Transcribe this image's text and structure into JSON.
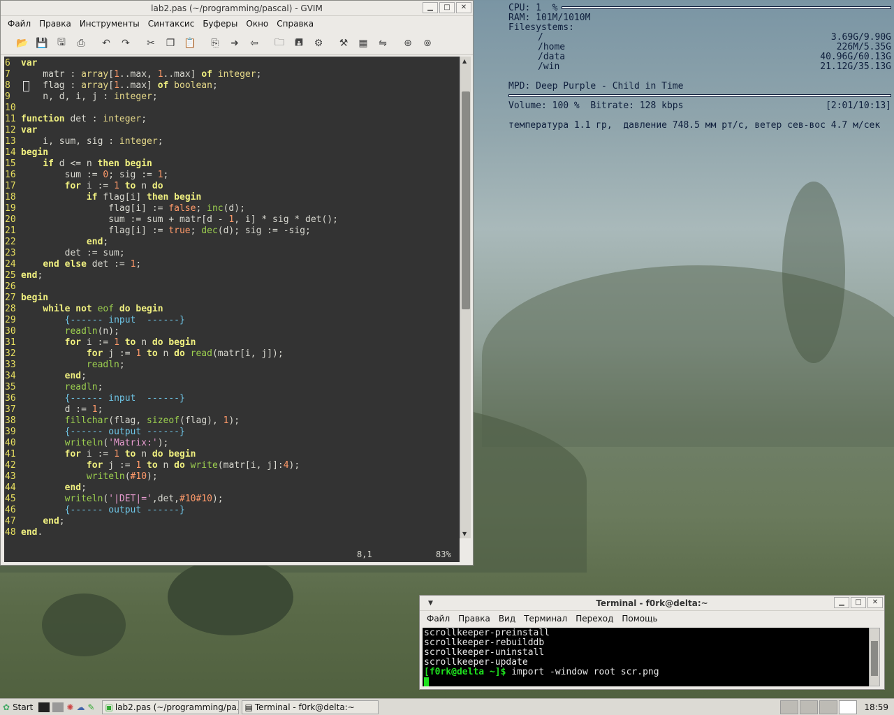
{
  "conky": {
    "cpu": "CPU: 1  %",
    "ram": "RAM: 101M/1010M",
    "fs_label": "Filesystems:",
    "filesystems": [
      {
        "mount": "/",
        "usage": "3.69G/9.90G"
      },
      {
        "mount": "/home",
        "usage": "226M/5.35G"
      },
      {
        "mount": "/data",
        "usage": "40.96G/60.13G"
      },
      {
        "mount": "/win",
        "usage": "21.12G/35.13G"
      }
    ],
    "mpd": "MPD: Deep Purple - Child in Time",
    "volume": "Volume: 100 %  Bitrate: 128 kbps",
    "time": "[2:01/10:13]",
    "weather": "температура 1.1 гр,  давление 748.5 мм рт/с, ветер сев-вос 4.7 м/сек"
  },
  "gvim": {
    "title": "lab2.pas (~/programming/pascal) - GVIM",
    "menu": [
      "Файл",
      "Правка",
      "Инструменты",
      "Синтаксис",
      "Буферы",
      "Окно",
      "Справка"
    ],
    "toolbar_icons": [
      "open-icon",
      "save-icon",
      "save-all-icon",
      "print-icon",
      "undo-icon",
      "redo-icon",
      "cut-icon",
      "copy-icon",
      "paste-icon",
      "find-replace-icon",
      "find-next-icon",
      "find-prev-icon",
      "load-session-icon",
      "save-session-icon",
      "run-script-icon",
      "make-icon",
      "tags-icon",
      "jump-tag-icon",
      "close-icon",
      "help-icon"
    ],
    "status_pos": "8,1",
    "status_pct": "83%"
  },
  "code_lines": [
    {
      "n": "6",
      "h": "<span class='kw'>var</span>"
    },
    {
      "n": "7",
      "h": "    matr : <span class='ty'>array</span>[<span class='nu'>1</span>..max, <span class='nu'>1</span>..max] <span class='kw'>of</span> <span class='ty'>integer</span>;"
    },
    {
      "n": "8",
      "h": "    flag : <span class='ty'>array</span>[<span class='nu'>1</span>..max] <span class='kw'>of</span> <span class='ty'>boolean</span>;"
    },
    {
      "n": "9",
      "h": "    n, d, i, j : <span class='ty'>integer</span>;"
    },
    {
      "n": "10",
      "h": ""
    },
    {
      "n": "11",
      "h": "<span class='kw'>function</span> det : <span class='ty'>integer</span>;"
    },
    {
      "n": "12",
      "h": "<span class='kw'>var</span>"
    },
    {
      "n": "13",
      "h": "    i, sum, sig : <span class='ty'>integer</span>;"
    },
    {
      "n": "14",
      "h": "<span class='kw'>begin</span>"
    },
    {
      "n": "15",
      "h": "    <span class='kw'>if</span> d &lt;= n <span class='kw'>then</span> <span class='kw'>begin</span>"
    },
    {
      "n": "16",
      "h": "        sum := <span class='nu'>0</span>; sig := <span class='nu'>1</span>;"
    },
    {
      "n": "17",
      "h": "        <span class='kw'>for</span> i := <span class='nu'>1</span> <span class='kw'>to</span> n <span class='kw'>do</span>"
    },
    {
      "n": "18",
      "h": "            <span class='kw'>if</span> flag[i] <span class='kw'>then</span> <span class='kw'>begin</span>"
    },
    {
      "n": "19",
      "h": "                flag[i] := <span class='nu'>false</span>; <span class='fn'>inc</span>(d);"
    },
    {
      "n": "20",
      "h": "                sum := sum + matr[d - <span class='nu'>1</span>, i] * sig * det();"
    },
    {
      "n": "21",
      "h": "                flag[i] := <span class='nu'>true</span>; <span class='fn'>dec</span>(d); sig := -sig;"
    },
    {
      "n": "22",
      "h": "            <span class='kw'>end</span>;"
    },
    {
      "n": "23",
      "h": "        det := sum;"
    },
    {
      "n": "24",
      "h": "    <span class='kw'>end</span> <span class='kw'>else</span> det := <span class='nu'>1</span>;"
    },
    {
      "n": "25",
      "h": "<span class='kw'>end</span>;"
    },
    {
      "n": "26",
      "h": ""
    },
    {
      "n": "27",
      "h": "<span class='kw'>begin</span>"
    },
    {
      "n": "28",
      "h": "    <span class='kw'>while</span> <span class='kw'>not</span> <span class='fn'>eof</span> <span class='kw'>do</span> <span class='kw'>begin</span>"
    },
    {
      "n": "29",
      "h": "        <span class='cm'>{------ input  ------}</span>"
    },
    {
      "n": "30",
      "h": "        <span class='fn'>readln</span>(n);"
    },
    {
      "n": "31",
      "h": "        <span class='kw'>for</span> i := <span class='nu'>1</span> <span class='kw'>to</span> n <span class='kw'>do</span> <span class='kw'>begin</span>"
    },
    {
      "n": "32",
      "h": "            <span class='kw'>for</span> j := <span class='nu'>1</span> <span class='kw'>to</span> n <span class='kw'>do</span> <span class='fn'>read</span>(matr[i, j]);"
    },
    {
      "n": "33",
      "h": "            <span class='fn'>readln</span>;"
    },
    {
      "n": "34",
      "h": "        <span class='kw'>end</span>;"
    },
    {
      "n": "35",
      "h": "        <span class='fn'>readln</span>;"
    },
    {
      "n": "36",
      "h": "        <span class='cm'>{------ input  ------}</span>"
    },
    {
      "n": "37",
      "h": "        d := <span class='nu'>1</span>;"
    },
    {
      "n": "38",
      "h": "        <span class='fn'>fillchar</span>(flag, <span class='fn'>sizeof</span>(flag), <span class='nu'>1</span>);"
    },
    {
      "n": "39",
      "h": "        <span class='cm'>{------ output ------}</span>"
    },
    {
      "n": "40",
      "h": "        <span class='fn'>writeln</span>(<span class='st'>'Matrix:'</span>);"
    },
    {
      "n": "41",
      "h": "        <span class='kw'>for</span> i := <span class='nu'>1</span> <span class='kw'>to</span> n <span class='kw'>do</span> <span class='kw'>begin</span>"
    },
    {
      "n": "42",
      "h": "            <span class='kw'>for</span> j := <span class='nu'>1</span> <span class='kw'>to</span> n <span class='kw'>do</span> <span class='fn'>write</span>(matr[i, j]:<span class='nu'>4</span>);"
    },
    {
      "n": "43",
      "h": "            <span class='fn'>writeln</span>(<span class='nu'>#10</span>);"
    },
    {
      "n": "44",
      "h": "        <span class='kw'>end</span>;"
    },
    {
      "n": "45",
      "h": "        <span class='fn'>writeln</span>(<span class='st'>'|DET|='</span>,det,<span class='nu'>#10#10</span>);"
    },
    {
      "n": "46",
      "h": "        <span class='cm'>{------ output ------}</span>"
    },
    {
      "n": "47",
      "h": "    <span class='kw'>end</span>;"
    },
    {
      "n": "48",
      "h": "<span class='kw'>end</span>."
    }
  ],
  "terminal": {
    "title": "Terminal - f0rk@delta:~",
    "menu": [
      "Файл",
      "Правка",
      "Вид",
      "Терминал",
      "Переход",
      "Помощь"
    ],
    "lines": [
      "scrollkeeper-preinstall",
      "scrollkeeper-rebuilddb",
      "scrollkeeper-uninstall",
      "scrollkeeper-update"
    ],
    "prompt": "[f0rk@delta ~]$",
    "command": " import -window root scr.png"
  },
  "taskbar": {
    "start": "Start",
    "tasks": [
      "lab2.pas (~/programming/pa...",
      "Terminal - f0rk@delta:~"
    ],
    "clock": "18:59"
  },
  "colors": {
    "editor_bg": "#333333",
    "line_number": "#e8e060",
    "keyword": "#f0f080",
    "terminal_bg": "#000000",
    "cursor": "#1ee01e"
  }
}
